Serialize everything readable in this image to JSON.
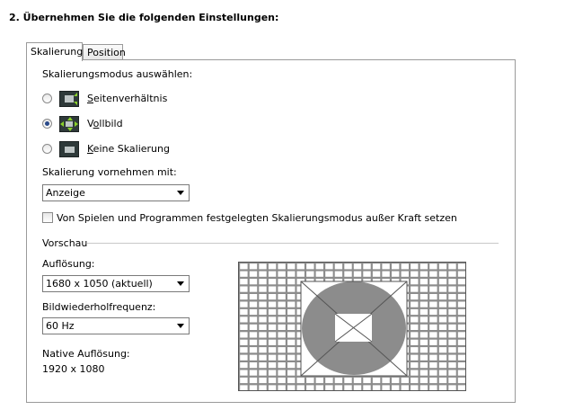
{
  "step_title": "2. Übernehmen Sie die folgenden Einstellungen:",
  "tabs": [
    {
      "label": "Skalierung",
      "active": true
    },
    {
      "label": "Position",
      "active": false
    }
  ],
  "scaling": {
    "mode_label": "Skalierungsmodus auswählen:",
    "options": [
      {
        "ul": "S",
        "rest": "eitenverhältnis",
        "checked": false,
        "icon": "aspect-ratio-icon"
      },
      {
        "pre": "V",
        "ul": "o",
        "rest": "llbild",
        "checked": true,
        "icon": "fullscreen-icon"
      },
      {
        "ul": "K",
        "rest": "eine Skalierung",
        "checked": false,
        "icon": "no-scaling-icon"
      }
    ],
    "perform_label": "Skalierung vornehmen mit:",
    "perform_value": "Anzeige",
    "override_label": "Von Spielen und Programmen festgelegten Skalierungsmodus außer Kraft setzen",
    "override_checked": false
  },
  "preview": {
    "section_label": "Vorschau",
    "resolution_label": "Auflösung:",
    "resolution_value": "1680 x 1050 (aktuell)",
    "refresh_label": "Bildwiederholfrequenz:",
    "refresh_value": "60 Hz",
    "native_label": "Native Auflösung:",
    "native_value": "1920 x 1080"
  },
  "colors": {
    "panel_border": "#9a9a9a",
    "grid_bg": "#8c8c8c",
    "grid_cell": "#ffffff",
    "radio_dot": "#2a4a8a",
    "icon_arrow": "#8ad12a"
  }
}
